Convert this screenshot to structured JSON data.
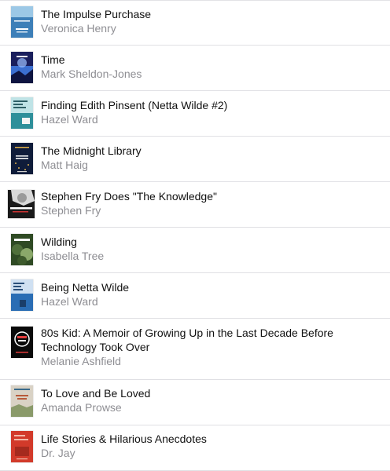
{
  "books": [
    {
      "title": "The Impulse Purchase",
      "author": "Veronica Henry",
      "cover_icon": "book-cover-impulse-purchase-icon",
      "cover_colors": [
        "#3d7fb8",
        "#9cc8e6"
      ]
    },
    {
      "title": "Time",
      "author": "Mark Sheldon-Jones",
      "cover_icon": "book-cover-time-icon",
      "cover_colors": [
        "#1a1f5c",
        "#3b6fd0"
      ]
    },
    {
      "title": "Finding Edith Pinsent (Netta Wilde #2)",
      "author": "Hazel Ward",
      "cover_icon": "book-cover-finding-edith-pinsent-icon",
      "cover_colors": [
        "#2e8f9a",
        "#bfe3e6"
      ]
    },
    {
      "title": "The Midnight Library",
      "author": "Matt Haig",
      "cover_icon": "book-cover-midnight-library-icon",
      "cover_colors": [
        "#0f1c3a",
        "#e0b04a"
      ]
    },
    {
      "title": "Stephen Fry Does \"The Knowledge\"",
      "author": "Stephen Fry",
      "cover_icon": "book-cover-stephen-fry-icon",
      "cover_colors": [
        "#1a1a1a",
        "#d8d8d8"
      ]
    },
    {
      "title": "Wilding",
      "author": "Isabella Tree",
      "cover_icon": "book-cover-wilding-icon",
      "cover_colors": [
        "#2f4a24",
        "#8aa86a"
      ]
    },
    {
      "title": "Being Netta Wilde",
      "author": "Hazel Ward",
      "cover_icon": "book-cover-being-netta-wilde-icon",
      "cover_colors": [
        "#2a6db4",
        "#cfe0f2"
      ]
    },
    {
      "title": "80s Kid: A Memoir of Growing Up in the Last Decade Before Technology Took Over",
      "author": "Melanie Ashfield",
      "cover_icon": "book-cover-80s-kid-icon",
      "cover_colors": [
        "#0a0a0a",
        "#e23b3b"
      ]
    },
    {
      "title": "To Love and Be Loved",
      "author": "Amanda Prowse",
      "cover_icon": "book-cover-to-love-and-be-loved-icon",
      "cover_colors": [
        "#d9d2c5",
        "#b85a3a"
      ]
    },
    {
      "title": "Life Stories & Hilarious Anecdotes",
      "author": "Dr. Jay",
      "cover_icon": "book-cover-life-stories-icon",
      "cover_colors": [
        "#d23a2a",
        "#f2b8a8"
      ]
    }
  ]
}
